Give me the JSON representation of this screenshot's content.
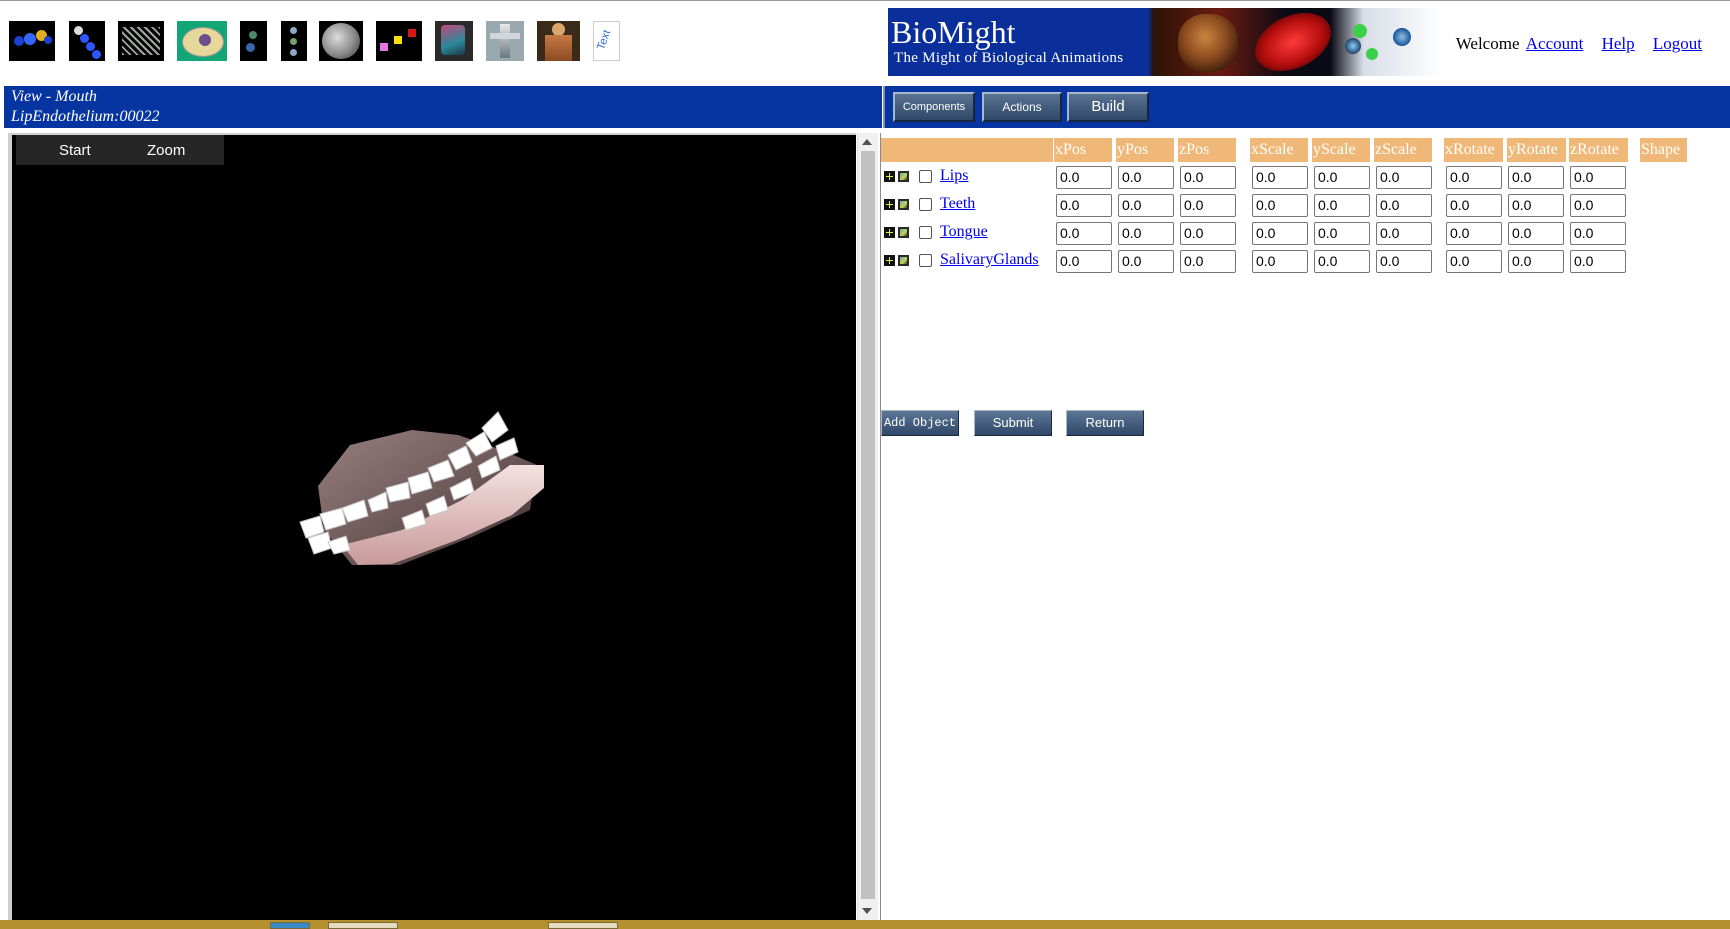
{
  "toolbar": {
    "icons": [
      {
        "name": "molecule-icon"
      },
      {
        "name": "atom-chain-icon"
      },
      {
        "name": "dna-helix-icon"
      },
      {
        "name": "cell-icon"
      },
      {
        "name": "virus-icon"
      },
      {
        "name": "chromosome-icon"
      },
      {
        "name": "sphere-icon"
      },
      {
        "name": "tissue-icon"
      },
      {
        "name": "organ-icon"
      },
      {
        "name": "skeleton-icon"
      },
      {
        "name": "human-body-icon"
      },
      {
        "name": "text-icon",
        "text": "Text"
      }
    ]
  },
  "banner": {
    "title": "BioMight",
    "subtitle": "The Might of Biological Animations"
  },
  "user_menu": {
    "welcome": "Welcome",
    "account": "Account",
    "help": "Help",
    "logout": "Logout"
  },
  "view": {
    "title": "View - Mouth",
    "object_id": "LipEndothelium:00022"
  },
  "tabs": {
    "components": "Components",
    "actions": "Actions",
    "build": "Build"
  },
  "viewer": {
    "menu": {
      "start": "Start",
      "zoom": "Zoom"
    }
  },
  "components_table": {
    "headers": [
      "xPos",
      "yPos",
      "zPos",
      "xScale",
      "yScale",
      "zScale",
      "xRotate",
      "yRotate",
      "zRotate",
      "Shape"
    ],
    "rows": [
      {
        "name": "Lips",
        "values": [
          "0.0",
          "0.0",
          "0.0",
          "0.0",
          "0.0",
          "0.0",
          "0.0",
          "0.0",
          "0.0"
        ]
      },
      {
        "name": "Teeth",
        "values": [
          "0.0",
          "0.0",
          "0.0",
          "0.0",
          "0.0",
          "0.0",
          "0.0",
          "0.0",
          "0.0"
        ]
      },
      {
        "name": "Tongue",
        "values": [
          "0.0",
          "0.0",
          "0.0",
          "0.0",
          "0.0",
          "0.0",
          "0.0",
          "0.0",
          "0.0"
        ]
      },
      {
        "name": "SalivaryGlands",
        "values": [
          "0.0",
          "0.0",
          "0.0",
          "0.0",
          "0.0",
          "0.0",
          "0.0",
          "0.0",
          "0.0"
        ]
      }
    ]
  },
  "actions": {
    "add_object": "Add Object",
    "submit": "Submit",
    "return": "Return"
  },
  "colors": {
    "header_blue": "#0634a0",
    "table_header": "#f0b878",
    "button_blue": "#3c5676",
    "viewer_bg": "#000000"
  }
}
